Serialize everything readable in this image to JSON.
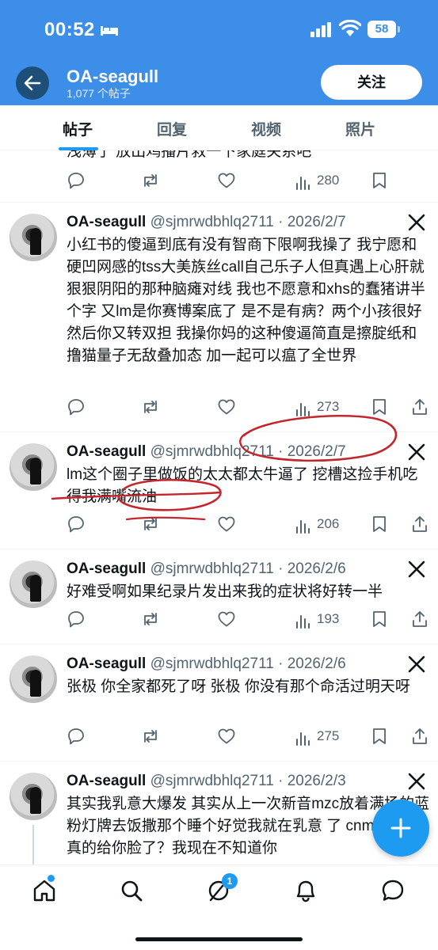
{
  "status_bar": {
    "time": "00:52",
    "battery": "58"
  },
  "header": {
    "name": "OA-seagull",
    "post_count": "1,077 个帖子",
    "follow_label": "关注"
  },
  "tabs": [
    {
      "label": "帖子",
      "active": true
    },
    {
      "label": "回复",
      "active": false
    },
    {
      "label": "视频",
      "active": false
    },
    {
      "label": "照片",
      "active": false
    }
  ],
  "partial_post": {
    "text": "浅薄了 放出鸡播片救一下家庭关系吧",
    "views": "280"
  },
  "posts": [
    {
      "name": "OA-seagull",
      "handle_date": "@sjmrwdbhlq2711 · 2026/2/7",
      "text": "小红书的傻逼到底有没有智商下限啊我操了 我宁愿和硬凹网感的tss大美族丝call自己乐子人但真遇上心肝就狠狠阴阳的那种脑瘫对线 我也不愿意和xhs的蠢猪讲半个字 又lm是你赛博案底了 是不是有病？两个小孩很好 然后你又转双担 我操你妈的这种傻逼简直是擦腚纸和撸猫量子无敌叠加态 加一起可以瘟了全世界",
      "views": "273"
    },
    {
      "name": "OA-seagull",
      "handle_date": "@sjmrwdbhlq2711 · 2026/2/7",
      "text": "lm这个圈子里做饭的太太都太牛逼了 挖槽这捡手机吃得我满嘴流油",
      "views": "206"
    },
    {
      "name": "OA-seagull",
      "handle_date": "@sjmrwdbhlq2711 · 2026/2/6",
      "text": "好难受啊如果纪录片发出来我的症状将好转一半",
      "views": "193"
    },
    {
      "name": "OA-seagull",
      "handle_date": "@sjmrwdbhlq2711 · 2026/2/6",
      "text": "张极 你全家都死了呀 张极 你没有那个命活过明天呀",
      "views": "275"
    },
    {
      "name": "OA-seagull",
      "handle_date": "@sjmrwdbhlq2711 · 2026/2/3",
      "text": "其实我乳意大爆发 其实从上一次新音mzc放着满场的蓝粉灯牌去饭撒那个睡个好觉我就在乳意 了 cnmd是不是真的给你脸了？我现在不知道你",
      "views": ""
    }
  ],
  "bottom_nav": {
    "badge": "1"
  },
  "colors": {
    "header_bg": "#3d8ee8",
    "accent": "#1d9bf0",
    "annotation_red": "#c1272d"
  }
}
